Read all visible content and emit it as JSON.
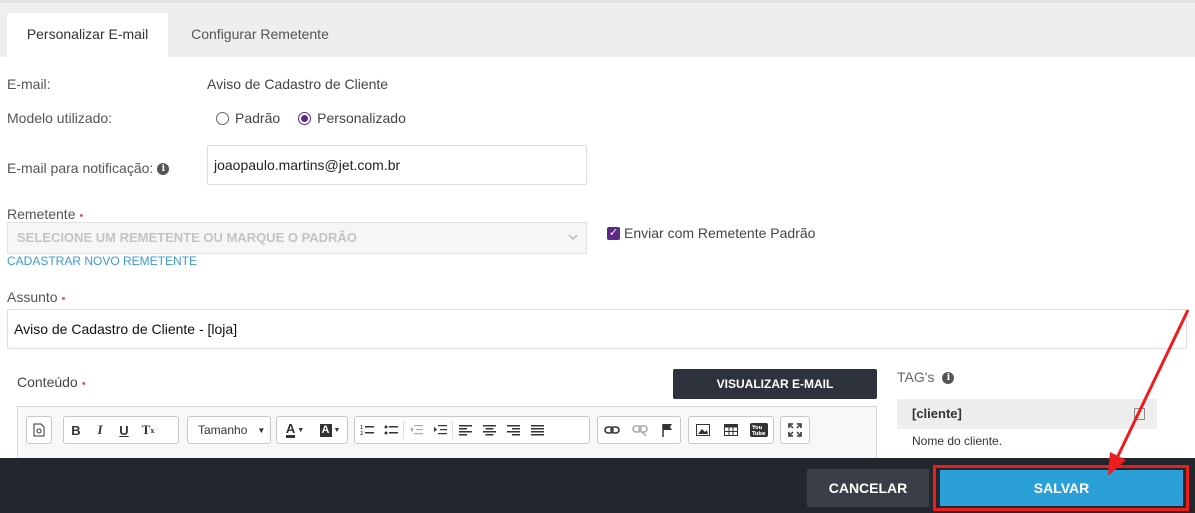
{
  "tabs": [
    {
      "label": "Personalizar E-mail",
      "active": true
    },
    {
      "label": "Configurar Remetente",
      "active": false
    }
  ],
  "form": {
    "email_label": "E-mail:",
    "email_value": "Aviso de Cadastro de Cliente",
    "model_label": "Modelo utilizado:",
    "model_options": [
      "Padrão",
      "Personalizado"
    ],
    "model_selected": "Personalizado",
    "notify_label": "E-mail para notificação:",
    "notify_value": "joaopaulo.martins@jet.com.br",
    "sender_label": "Remetente",
    "sender_placeholder": "SELECIONE UM REMETENTE OU MARQUE O PADRÃO",
    "sender_default_label": "Enviar com Remetente Padrão",
    "sender_default_checked": true,
    "new_sender_link": "CADASTRAR NOVO REMETENTE",
    "subject_label": "Assunto",
    "subject_value": "Aviso de Cadastro de Cliente - [loja]",
    "content_label": "Conteúdo",
    "required_mark": "•"
  },
  "editor": {
    "preview_button": "VISUALIZAR E-MAIL",
    "font_size_label": "Tamanho",
    "toolbar_icons": [
      "source-icon",
      "bold-icon",
      "italic-icon",
      "underline-icon",
      "remove-format-icon",
      "font-size-select",
      "text-color-icon",
      "bg-color-icon",
      "numbered-list-icon",
      "bulleted-list-icon",
      "outdent-icon",
      "indent-icon",
      "align-left-icon",
      "align-center-icon",
      "align-right-icon",
      "justify-icon",
      "link-icon",
      "unlink-icon",
      "anchor-icon",
      "image-icon",
      "table-icon",
      "youtube-icon",
      "maximize-icon"
    ]
  },
  "tags": {
    "title": "TAG's",
    "items": [
      {
        "tag": "[cliente]",
        "description": "Nome do cliente."
      }
    ]
  },
  "footer": {
    "cancel_label": "CANCELAR",
    "save_label": "SALVAR"
  },
  "colors": {
    "accent": "#5b2a86",
    "save": "#2a9fd8",
    "highlight": "#ee1c1c",
    "footer": "#23262c"
  }
}
